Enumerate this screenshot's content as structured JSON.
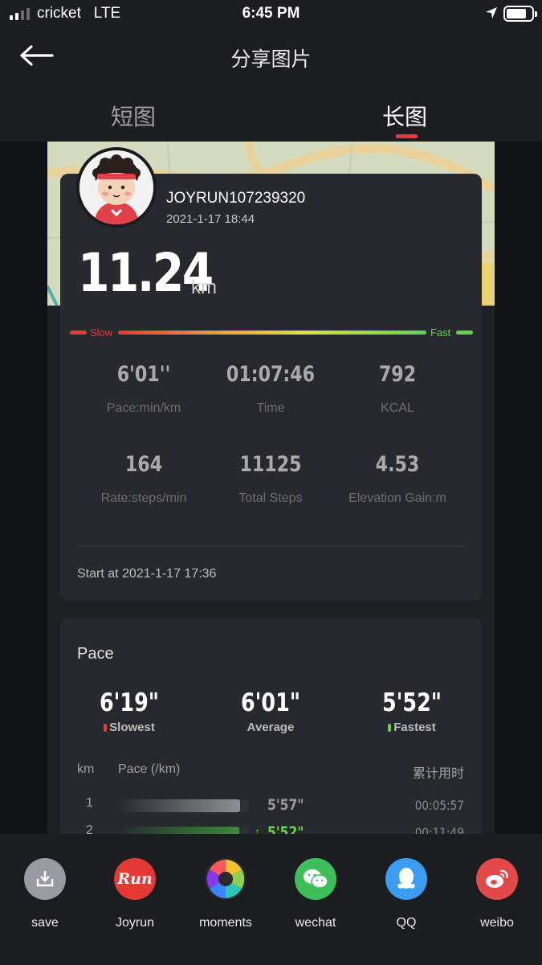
{
  "status_bar": {
    "carrier": "cricket",
    "network": "LTE",
    "time": "6:45 PM"
  },
  "header": {
    "title": "分享图片",
    "tabs": [
      {
        "label": "短图"
      },
      {
        "label": "长图"
      }
    ],
    "active_tab": "长图"
  },
  "profile": {
    "username": "JOYRUN107239320",
    "datetime": "2021-1-17 18:44"
  },
  "run": {
    "distance": "11.24",
    "distance_unit": "km",
    "speed_bar": {
      "slow_label": "Slow",
      "fast_label": "Fast"
    },
    "stats": [
      {
        "value": "6'01''",
        "label": "Pace:min/km"
      },
      {
        "value": "01:07:46",
        "label": "Time"
      },
      {
        "value": "792",
        "label": "KCAL"
      },
      {
        "value": "164",
        "label": "Rate:steps/min"
      },
      {
        "value": "11125",
        "label": "Total Steps"
      },
      {
        "value": "4.53",
        "label": "Elevation Gain:m"
      }
    ],
    "start_at": "Start at 2021-1-17 17:36"
  },
  "pace": {
    "title": "Pace",
    "summary": [
      {
        "value": "6'19\"",
        "label": "Slowest",
        "dot_color": "#e53935"
      },
      {
        "value": "6'01\"",
        "label": "Average"
      },
      {
        "value": "5'52\"",
        "label": "Fastest",
        "dot_color": "#66d24a"
      }
    ],
    "table_headers": {
      "km": "km",
      "pace": "Pace (/km)",
      "cumulative": "累计用时"
    },
    "rows": [
      {
        "km": "1",
        "pace": "5'57\"",
        "cumulative": "00:05:57",
        "bar_fraction": 0.94,
        "bar_color": "#8f9094",
        "fastest": false
      },
      {
        "km": "2",
        "pace": "5'52\"",
        "cumulative": "00:11:49",
        "bar_fraction": 0.93,
        "bar_color": "#3b8a3a",
        "fastest": true
      }
    ]
  },
  "share_bar": {
    "items": [
      {
        "label": "save",
        "icon": "download-icon",
        "color": "#9a9aa3"
      },
      {
        "label": "Joyrun",
        "icon": "joyrun-logo-icon",
        "color": "#e53935",
        "icon_text": "Run"
      },
      {
        "label": "moments",
        "icon": "aperture-icon",
        "color": "#333333"
      },
      {
        "label": "wechat",
        "icon": "wechat-icon",
        "color": "#3fbf5a"
      },
      {
        "label": "QQ",
        "icon": "qq-penguin-icon",
        "color": "#3b9cf2"
      },
      {
        "label": "weibo",
        "icon": "weibo-icon",
        "color": "#e24a4a"
      }
    ]
  }
}
